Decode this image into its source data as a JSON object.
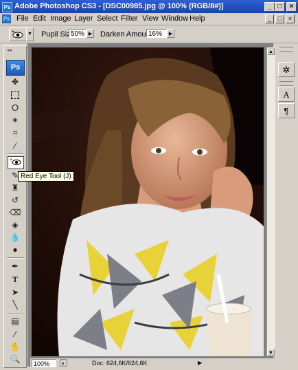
{
  "window": {
    "app_icon_text": "Ps",
    "title": "Adobe Photoshop CS3 - [DSC00985.jpg @ 100% (RGB/8#)]",
    "minimize_glyph": "_",
    "maximize_glyph": "□",
    "close_glyph": "×"
  },
  "menu": {
    "items": [
      "File",
      "Edit",
      "Image",
      "Layer",
      "Select",
      "Filter",
      "View",
      "Window",
      "Help"
    ]
  },
  "options": {
    "pupil_size_label": "Pupil Size:",
    "pupil_size_value": "50%",
    "darken_amount_label": "Darken Amount:",
    "darken_amount_value": "16%"
  },
  "toolbox": {
    "logo_text": "Ps",
    "active_tool": "red-eye-tool",
    "tooltip": "Red Eye Tool (J)"
  },
  "status": {
    "zoom": "100%",
    "doc_info": "Doc: 624,6K/624,6K"
  },
  "panels": {
    "paragraph_glyph": "¶",
    "character_glyph": "A"
  },
  "colors": {
    "titlebar": "#1b43a8",
    "chrome": "#d4d0c8",
    "canvas_bg": "#808080",
    "tooltip_bg": "#ffffe1",
    "ps_blue": "#1f6fd0"
  }
}
